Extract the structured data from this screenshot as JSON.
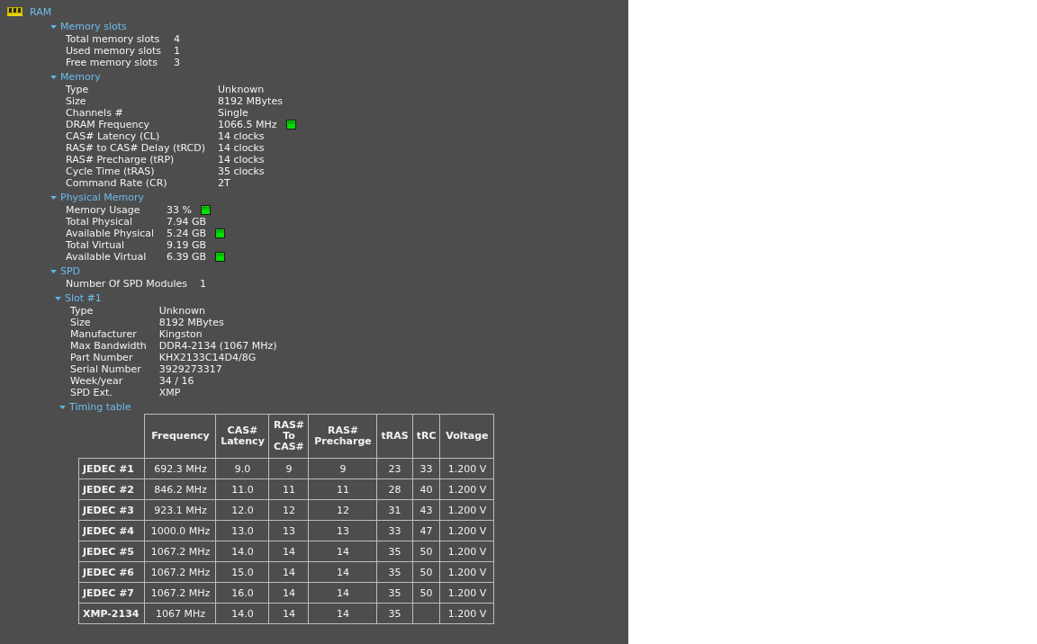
{
  "root": {
    "title": "RAM",
    "sections": [
      {
        "title": "Memory slots",
        "expanded": true,
        "rows": [
          {
            "label": "Total memory slots",
            "value": "4",
            "graph": false
          },
          {
            "label": "Used memory slots",
            "value": "1",
            "graph": false
          },
          {
            "label": "Free memory slots",
            "value": "3",
            "graph": false
          }
        ]
      },
      {
        "title": "Memory",
        "expanded": true,
        "rows": [
          {
            "label": "Type",
            "value": "Unknown",
            "graph": false
          },
          {
            "label": "Size",
            "value": "8192 MBytes",
            "graph": false
          },
          {
            "label": "Channels #",
            "value": "Single",
            "graph": false
          },
          {
            "label": "DRAM Frequency",
            "value": "1066.5 MHz",
            "graph": true
          },
          {
            "label": "CAS# Latency (CL)",
            "value": "14 clocks",
            "graph": false
          },
          {
            "label": "RAS# to CAS# Delay (tRCD)",
            "value": "14 clocks",
            "graph": false
          },
          {
            "label": "RAS# Precharge (tRP)",
            "value": "14 clocks",
            "graph": false
          },
          {
            "label": "Cycle Time (tRAS)",
            "value": "35 clocks",
            "graph": false
          },
          {
            "label": "Command Rate (CR)",
            "value": "2T",
            "graph": false
          }
        ]
      },
      {
        "title": "Physical Memory",
        "expanded": true,
        "rows": [
          {
            "label": "Memory Usage",
            "value": "33 %",
            "graph": true
          },
          {
            "label": "Total Physical",
            "value": "7.94 GB",
            "graph": false
          },
          {
            "label": "Available Physical",
            "value": "5.24 GB",
            "graph": true
          },
          {
            "label": "Total Virtual",
            "value": "9.19 GB",
            "graph": false
          },
          {
            "label": "Available Virtual",
            "value": "6.39 GB",
            "graph": true
          }
        ]
      },
      {
        "title": "SPD",
        "expanded": true,
        "rows": [
          {
            "label": "Number Of SPD Modules",
            "value": "1",
            "graph": false
          }
        ],
        "children": [
          {
            "title": "Slot #1",
            "expanded": true,
            "rows": [
              {
                "label": "Type",
                "value": "Unknown",
                "graph": false
              },
              {
                "label": "Size",
                "value": "8192 MBytes",
                "graph": false
              },
              {
                "label": "Manufacturer",
                "value": "Kingston",
                "graph": false
              },
              {
                "label": "Max Bandwidth",
                "value": "DDR4-2134 (1067 MHz)",
                "graph": false
              },
              {
                "label": "Part Number",
                "value": "KHX2133C14D4/8G",
                "graph": false
              },
              {
                "label": "Serial Number",
                "value": "3929273317",
                "graph": false
              },
              {
                "label": "Week/year",
                "value": "34 / 16",
                "graph": false
              },
              {
                "label": "SPD Ext.",
                "value": "XMP",
                "graph": false
              }
            ],
            "children": [
              {
                "title": "Timing table",
                "expanded": true,
                "table": {
                  "columns": [
                    "Frequency",
                    "CAS# Latency",
                    "RAS# To CAS#",
                    "RAS# Precharge",
                    "tRAS",
                    "tRC",
                    "Voltage"
                  ],
                  "rows": [
                    {
                      "name": "JEDEC #1",
                      "cells": [
                        "692.3 MHz",
                        "9.0",
                        "9",
                        "9",
                        "23",
                        "33",
                        "1.200 V"
                      ]
                    },
                    {
                      "name": "JEDEC #2",
                      "cells": [
                        "846.2 MHz",
                        "11.0",
                        "11",
                        "11",
                        "28",
                        "40",
                        "1.200 V"
                      ]
                    },
                    {
                      "name": "JEDEC #3",
                      "cells": [
                        "923.1 MHz",
                        "12.0",
                        "12",
                        "12",
                        "31",
                        "43",
                        "1.200 V"
                      ]
                    },
                    {
                      "name": "JEDEC #4",
                      "cells": [
                        "1000.0 MHz",
                        "13.0",
                        "13",
                        "13",
                        "33",
                        "47",
                        "1.200 V"
                      ]
                    },
                    {
                      "name": "JEDEC #5",
                      "cells": [
                        "1067.2 MHz",
                        "14.0",
                        "14",
                        "14",
                        "35",
                        "50",
                        "1.200 V"
                      ]
                    },
                    {
                      "name": "JEDEC #6",
                      "cells": [
                        "1067.2 MHz",
                        "15.0",
                        "14",
                        "14",
                        "35",
                        "50",
                        "1.200 V"
                      ]
                    },
                    {
                      "name": "JEDEC #7",
                      "cells": [
                        "1067.2 MHz",
                        "16.0",
                        "14",
                        "14",
                        "35",
                        "50",
                        "1.200 V"
                      ]
                    },
                    {
                      "name": "XMP-2134",
                      "cells": [
                        "1067 MHz",
                        "14.0",
                        "14",
                        "14",
                        "35",
                        null,
                        "1.200 V"
                      ]
                    }
                  ]
                }
              }
            ]
          }
        ]
      }
    ]
  }
}
